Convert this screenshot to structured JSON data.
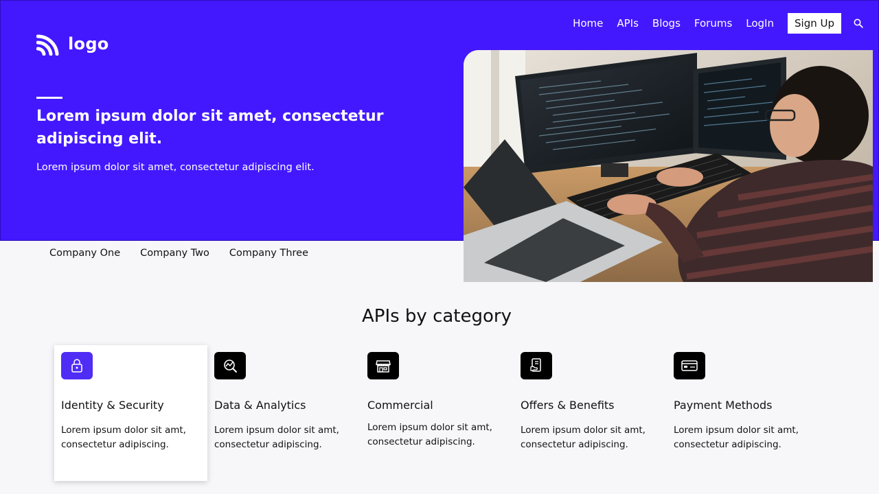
{
  "header": {
    "logo_text": "logo",
    "nav": [
      "Home",
      "APIs",
      "Blogs",
      "Forums",
      "LogIn"
    ],
    "signup_label": "Sign Up"
  },
  "hero": {
    "title": "Lorem ipsum dolor sit amet, consectetur adipiscing elit.",
    "subtitle": "Lorem ipsum dolor sit amet, consectetur adipiscing elit.",
    "image": "developer-at-desk-photo"
  },
  "companies": [
    "Company One",
    "Company Two",
    "Company Three"
  ],
  "section_title": "APIs by category",
  "categories": [
    {
      "title": "Identity & Security",
      "desc": "Lorem ipsum dolor sit amt, consectetur adipiscing.",
      "icon": "lock-icon"
    },
    {
      "title": "Data & Analytics",
      "desc": "Lorem ipsum dolor sit amt, consectetur adipiscing.",
      "icon": "analytics-icon"
    },
    {
      "title": "Commercial",
      "desc": "Lorem ipsum dolor sit amt, consectetur adipiscing.",
      "icon": "store-icon"
    },
    {
      "title": "Offers & Benefits",
      "desc": "Lorem ipsum dolor sit amt, consectetur adipiscing.",
      "icon": "offer-icon"
    },
    {
      "title": "Payment Methods",
      "desc": "Lorem ipsum dolor sit amt, consectetur adipiscing.",
      "icon": "card-icon"
    }
  ],
  "colors": {
    "brand": "#4318ff",
    "icon_active": "#4f2df5"
  }
}
